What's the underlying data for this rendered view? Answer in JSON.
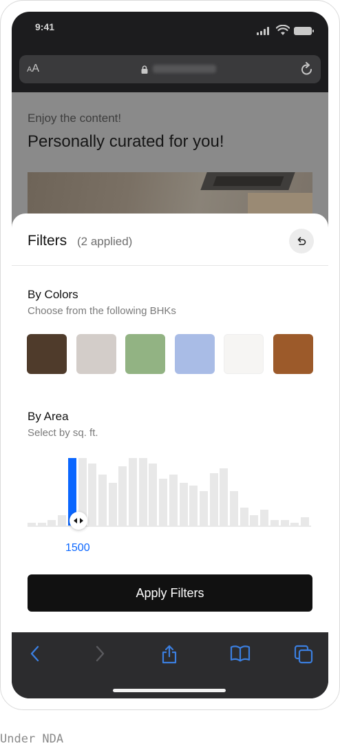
{
  "status": {
    "time": "9:41"
  },
  "browser": {
    "aa_small": "A",
    "aa_large": "A"
  },
  "page": {
    "eyebrow": "Enjoy the content!",
    "heading": "Personally curated for you!"
  },
  "filters": {
    "title": "Filters",
    "applied": "(2 applied)",
    "colors": {
      "title": "By Colors",
      "subtitle": "Choose from the following BHKs",
      "swatches": [
        "#4f3b2b",
        "#d3cdc9",
        "#92b383",
        "#a9bce6",
        "#f6f5f3",
        "#9c5a2a"
      ]
    },
    "area": {
      "title": "By Area",
      "subtitle": "Select by sq. ft.",
      "selected_value": "1500",
      "histogram_levels": [
        0.06,
        0.06,
        0.1,
        0.17,
        1.0,
        1.0,
        0.92,
        0.76,
        0.64,
        0.88,
        1.0,
        1.0,
        0.92,
        0.7,
        0.76,
        0.64,
        0.6,
        0.52,
        0.78,
        0.85,
        0.52,
        0.28,
        0.17,
        0.25,
        0.1,
        0.1,
        0.06,
        0.14
      ],
      "active_bar_index": 4
    },
    "apply_label": "Apply Filters"
  },
  "icons": {
    "lock": "lock-icon",
    "reload": "reload-icon",
    "reset": "undo-icon",
    "back": "chevron-left-icon",
    "forward": "chevron-right-icon",
    "share": "share-icon",
    "bookmarks": "book-icon",
    "tabs": "tabs-icon"
  },
  "colors": {
    "accent": "#0a66ff",
    "primary_button": "#111111"
  },
  "footer": {
    "note": "Under NDA"
  }
}
